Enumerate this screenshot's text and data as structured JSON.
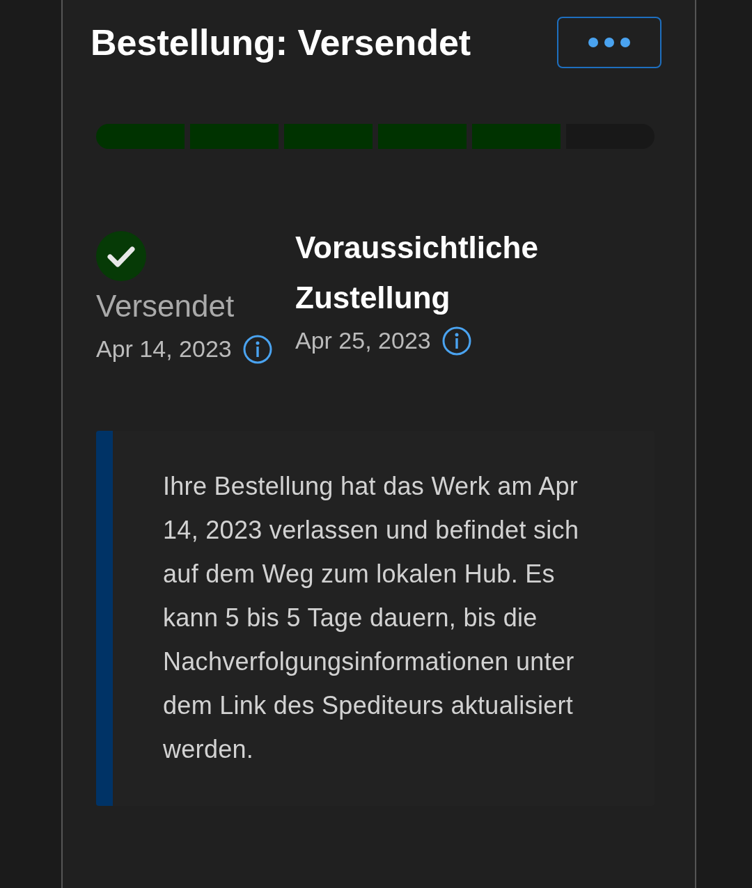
{
  "title": "Bestellung: Versendet",
  "progress": {
    "segments": [
      {
        "filled": true
      },
      {
        "filled": true
      },
      {
        "filled": true
      },
      {
        "filled": true
      },
      {
        "filled": true
      },
      {
        "filled": false
      }
    ]
  },
  "steps": [
    {
      "kind": "status",
      "done": true,
      "label": "Versendet",
      "date": "Apr 14, 2023"
    },
    {
      "kind": "estimate",
      "done": false,
      "label": "Voraussichtliche Zustellung",
      "date": "Apr 25, 2023"
    }
  ],
  "message": "Ihre Bestellung hat das Werk am Apr 14, 2023 verlassen und befindet sich auf dem Weg zum lokalen Hub. Es kann 5 bis 5 Tage dauern, bis die Nachverfolgungsinformationen unter dem Link des Spediteurs aktualisiert werden."
}
